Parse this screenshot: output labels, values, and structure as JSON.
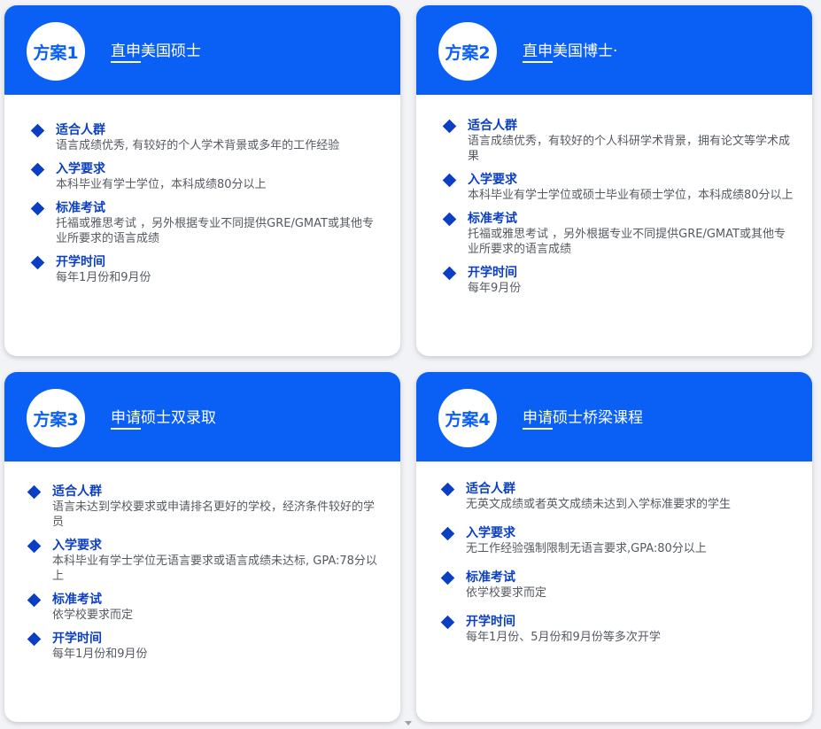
{
  "accent_color": "#0a5ff5",
  "label_color": "#0a3fc4",
  "bullet_icon": "diamond-icon",
  "cards": [
    {
      "badge": "方案1",
      "title": "直申美国硕士",
      "items": [
        {
          "label": "适合人群",
          "text": "语言成绩优秀, 有较好的个人学术背景或多年的工作经验"
        },
        {
          "label": "入学要求",
          "text": "本科毕业有学士学位，本科成绩80分以上"
        },
        {
          "label": "标准考试",
          "text": "托福或雅思考试 ，另外根据专业不同提供GRE/GMAT或其他专业所要求的语言成绩"
        },
        {
          "label": "开学时间",
          "text": "每年1月份和9月份"
        }
      ]
    },
    {
      "badge": "方案2",
      "title": "直申美国博士·",
      "items": [
        {
          "label": "适合人群",
          "text": "语言成绩优秀，有较好的个人科研学术背景，拥有论文等学术成果"
        },
        {
          "label": "入学要求",
          "text": "本科毕业有学士学位或硕士毕业有硕士学位，本科成绩80分以上"
        },
        {
          "label": "标准考试",
          "text": "托福或雅思考试 ，另外根据专业不同提供GRE/GMAT或其他专业所要求的语言成绩"
        },
        {
          "label": "开学时间",
          "text": "每年9月份"
        }
      ]
    },
    {
      "badge": "方案3",
      "title": "申请硕士双录取",
      "items": [
        {
          "label": "适合人群",
          "text": "语言未达到学校要求或申请排名更好的学校，经济条件较好的学员"
        },
        {
          "label": "入学要求",
          "text": "本科毕业有学士学位无语言要求或语言成绩未达标, GPA:78分以上"
        },
        {
          "label": "标准考试",
          "text": "依学校要求而定"
        },
        {
          "label": "开学时间",
          "text": "每年1月份和9月份"
        }
      ]
    },
    {
      "badge": "方案4",
      "title": "申请硕士桥梁课程",
      "items": [
        {
          "label": "适合人群",
          "text": "无英文成绩或者英文成绩未达到入学标准要求的学生"
        },
        {
          "label": "入学要求",
          "text": "无工作经验强制限制无语言要求,GPA:80分以上"
        },
        {
          "label": "标准考试",
          "text": "依学校要求而定"
        },
        {
          "label": "开学时间",
          "text": "每年1月份、5月份和9月份等多次开学"
        }
      ]
    }
  ]
}
